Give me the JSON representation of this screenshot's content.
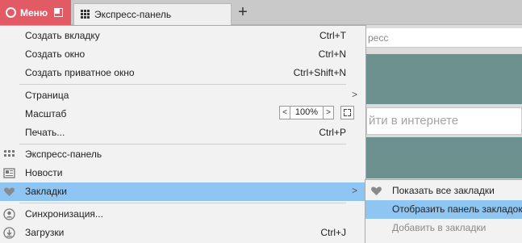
{
  "browser": {
    "menu_button_label": "Меню",
    "tab_title": "Экспресс-панель",
    "new_tab_symbol": "+"
  },
  "page": {
    "address_fragment": "ресс",
    "search_placeholder_fragment": "йти в интернете"
  },
  "menu": {
    "items": [
      {
        "label": "Создать вкладку",
        "shortcut": "Ctrl+T"
      },
      {
        "label": "Создать окно",
        "shortcut": "Ctrl+N"
      },
      {
        "label": "Создать приватное окно",
        "shortcut": "Ctrl+Shift+N"
      },
      {
        "label": "Страница",
        "arrow": ">"
      },
      {
        "label": "Масштаб",
        "zoom_value": "100%",
        "zoom_dec": "<",
        "zoom_inc": ">"
      },
      {
        "label": "Печать...",
        "shortcut": "Ctrl+P"
      },
      {
        "label": "Экспресс-панель",
        "icon": "speed-dial-icon"
      },
      {
        "label": "Новости",
        "icon": "news-icon"
      },
      {
        "label": "Закладки",
        "icon": "heart-icon",
        "arrow": ">",
        "state": "highlighted"
      },
      {
        "label": "Синхронизация...",
        "icon": "person-icon"
      },
      {
        "label": "Загрузки",
        "icon": "download-icon",
        "shortcut": "Ctrl+J"
      }
    ]
  },
  "bookmarks_submenu": {
    "items": [
      {
        "label": "Показать все закладки",
        "icon": "heart-icon"
      },
      {
        "label": "Отобразить панель закладок",
        "state": "highlighted"
      },
      {
        "label": "Добавить в закладки",
        "state": "disabled"
      }
    ]
  },
  "colors": {
    "opera_red": "#e25a63",
    "highlight": "#8ec5f2",
    "speed_dial_teal": "#6d918e",
    "menu_bg": "#f2f2f2"
  }
}
